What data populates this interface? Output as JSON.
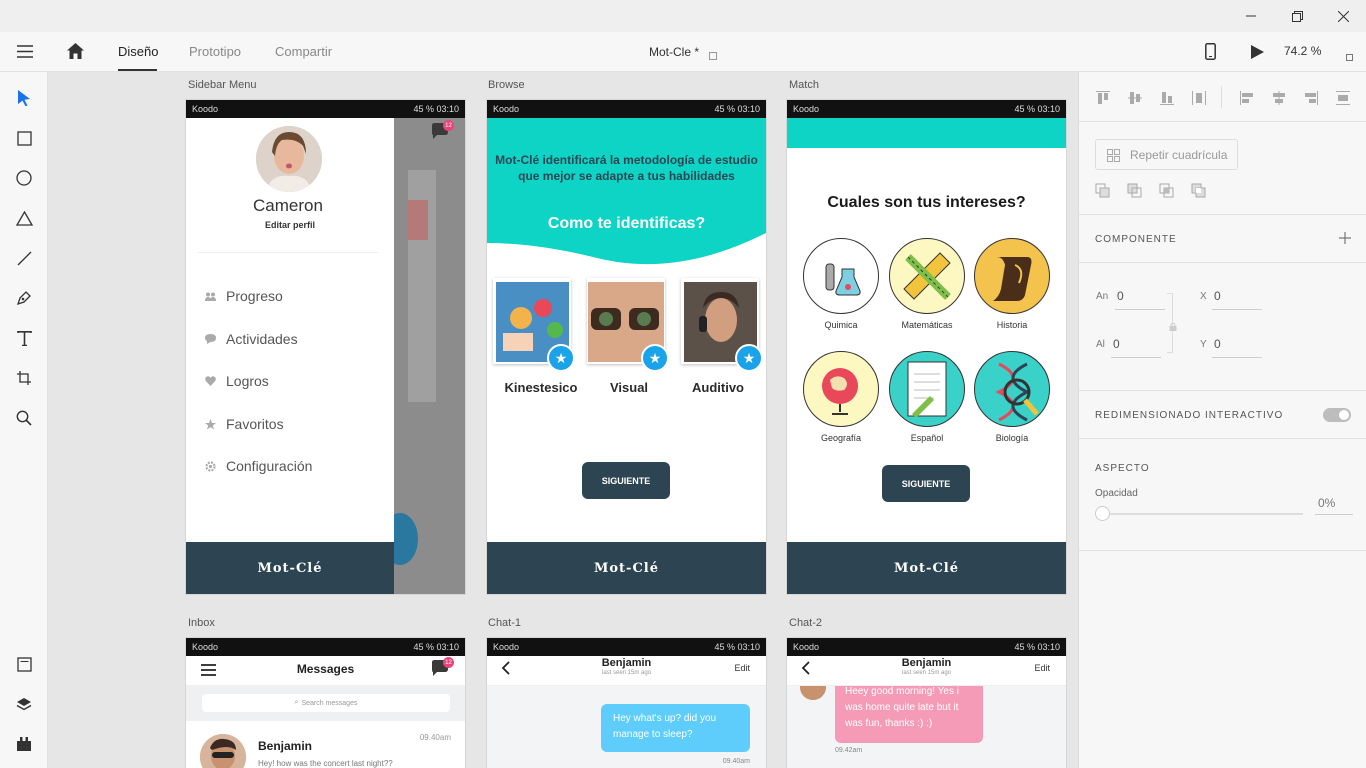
{
  "window": {
    "minimize_icon": "minimize-icon",
    "restore_icon": "restore-icon",
    "close_icon": "close-icon"
  },
  "appbar": {
    "tabs": [
      {
        "label": "Diseño",
        "active": true
      },
      {
        "label": "Prototipo"
      },
      {
        "label": "Compartir"
      }
    ],
    "doc_title": "Mot-Cle *",
    "zoom": "74.2 %"
  },
  "artboards": {
    "sidebar": {
      "label": "Sidebar Menu",
      "carrier": "Koodo",
      "status": "45 % 03:10",
      "name": "Cameron",
      "edit": "Editar perfil",
      "badge": "12",
      "menu": [
        "Progreso",
        "Actividades",
        "Logros",
        "Favoritos",
        "Configuración"
      ],
      "footer": "Mot-Clé"
    },
    "browse": {
      "label": "Browse",
      "carrier": "Koodo",
      "status": "45 % 03:10",
      "intro": "Mot-Clé identificará la metodología de estudio que mejor se adapte a tus habilidades",
      "question": "Como te identificas?",
      "cards": [
        "Kinestesico",
        "Visual",
        "Auditivo"
      ],
      "button": "SIGUIENTE",
      "footer": "Mot-Clé"
    },
    "match": {
      "label": "Match",
      "carrier": "Koodo",
      "status": "45 % 03:10",
      "question": "Cuales son tus intereses?",
      "interests": [
        "Quimica",
        "Matemáticas",
        "Historia",
        "Geografía",
        "Español",
        "Biología"
      ],
      "button": "SIGUIENTE",
      "footer": "Mot-Clé"
    },
    "inbox": {
      "label": "Inbox",
      "carrier": "Koodo",
      "status": "45 % 03:10",
      "title": "Messages",
      "badge": "12",
      "search_placeholder": "Search messages",
      "first_name": "Benjamin",
      "first_time": "09.40am",
      "first_preview": "Hey! how was the concert last night??"
    },
    "chat1": {
      "label": "Chat-1",
      "carrier": "Koodo",
      "status": "45 % 03:10",
      "name": "Benjamin",
      "last_seen": "last seen 15m ago",
      "edit": "Edit",
      "message": "Hey what's up? did you manage to sleep?",
      "time": "09.40am"
    },
    "chat2": {
      "label": "Chat-2",
      "carrier": "Koodo",
      "status": "45 % 03:10",
      "name": "Benjamin",
      "last_seen": "last seen 15m ago",
      "edit": "Edit",
      "message": "Heey good morning! Yes i was home quite late but it was fun, thanks :) :)",
      "time": "09.42am"
    }
  },
  "rpanel": {
    "repeat": "Repetir cuadrícula",
    "component": "COMPONENTE",
    "w_label": "An",
    "w": "0",
    "h_label": "Al",
    "h": "0",
    "x_label": "X",
    "x": "0",
    "y_label": "Y",
    "y": "0",
    "responsive": "REDIMENSIONADO INTERACTIVO",
    "appearance": "ASPECTO",
    "opacity_label": "Opacidad",
    "opacity_value": "0%"
  },
  "colors": {
    "teal": "#0dd4c4",
    "navy": "#2d4452",
    "accent": "#1aa3e8",
    "pink": "#f59bb8",
    "bubble_blue": "#5ecdfc"
  }
}
